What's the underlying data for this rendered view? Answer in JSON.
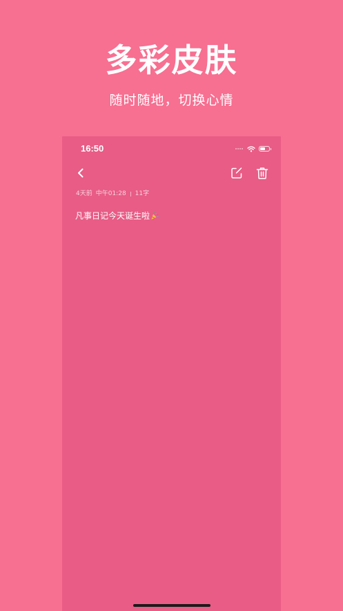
{
  "promo": {
    "headline": "多彩皮肤",
    "subline": "随时随地，切换心情"
  },
  "status_bar": {
    "time": "16:50",
    "icons": [
      "cellular-signal-icon",
      "wifi-icon",
      "battery-icon"
    ]
  },
  "nav_bar": {
    "icons": [
      "back-chevron-icon",
      "edit-icon",
      "trash-icon"
    ]
  },
  "note": {
    "date_relative": "4天前",
    "time": "中午01:28",
    "char_count": "11字",
    "body": "凡事日记今天诞生啦",
    "body_emoji": "party-popper-icon"
  },
  "colors": {
    "background": "#f76f91",
    "screen": "#e85c86",
    "text": "#ffffff"
  }
}
